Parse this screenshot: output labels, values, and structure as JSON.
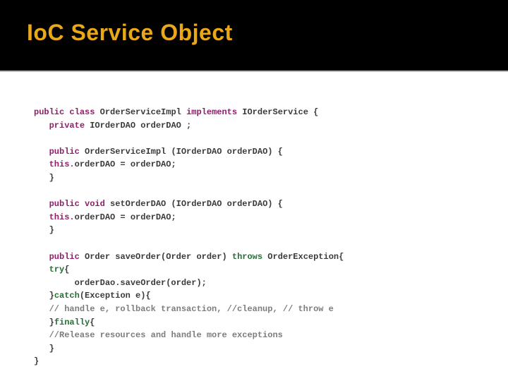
{
  "title": "IoC Service Object",
  "code": {
    "l1a": "public",
    "l1b": "class",
    "l1c": " OrderServiceImpl ",
    "l1d": "implements",
    "l1e": " IOrderService {",
    "l2a": "private",
    "l2b": " IOrderDAO orderDAO ;",
    "l3": "",
    "l4a": "public",
    "l4b": " OrderServiceImpl (IOrderDAO orderDAO) {",
    "l5a": "this.",
    "l5b": "orderDAO = orderDAO;",
    "l6": "}",
    "l7": "",
    "l8a": "public",
    "l8b": "void",
    "l8c": " setOrderDAO (IOrderDAO orderDAO) {",
    "l9a": "this.",
    "l9b": "orderDAO = orderDAO;",
    "l10": "}",
    "l11": "",
    "l12a": "public",
    "l12b": " Order saveOrder(Order order) ",
    "l12c": "throws",
    "l12d": " OrderException{",
    "l13a": "try",
    "l13b": "{",
    "l14": "orderDao.saveOrder(order);",
    "l15a": "}",
    "l15b": "catch",
    "l15c": "(Exception e){",
    "l16": "// handle e, rollback transaction, //cleanup, // throw e",
    "l17a": "}",
    "l17b": "finally",
    "l17c": "{",
    "l18": "//Release resources and handle more exceptions",
    "l19": "}",
    "l20": "}"
  }
}
